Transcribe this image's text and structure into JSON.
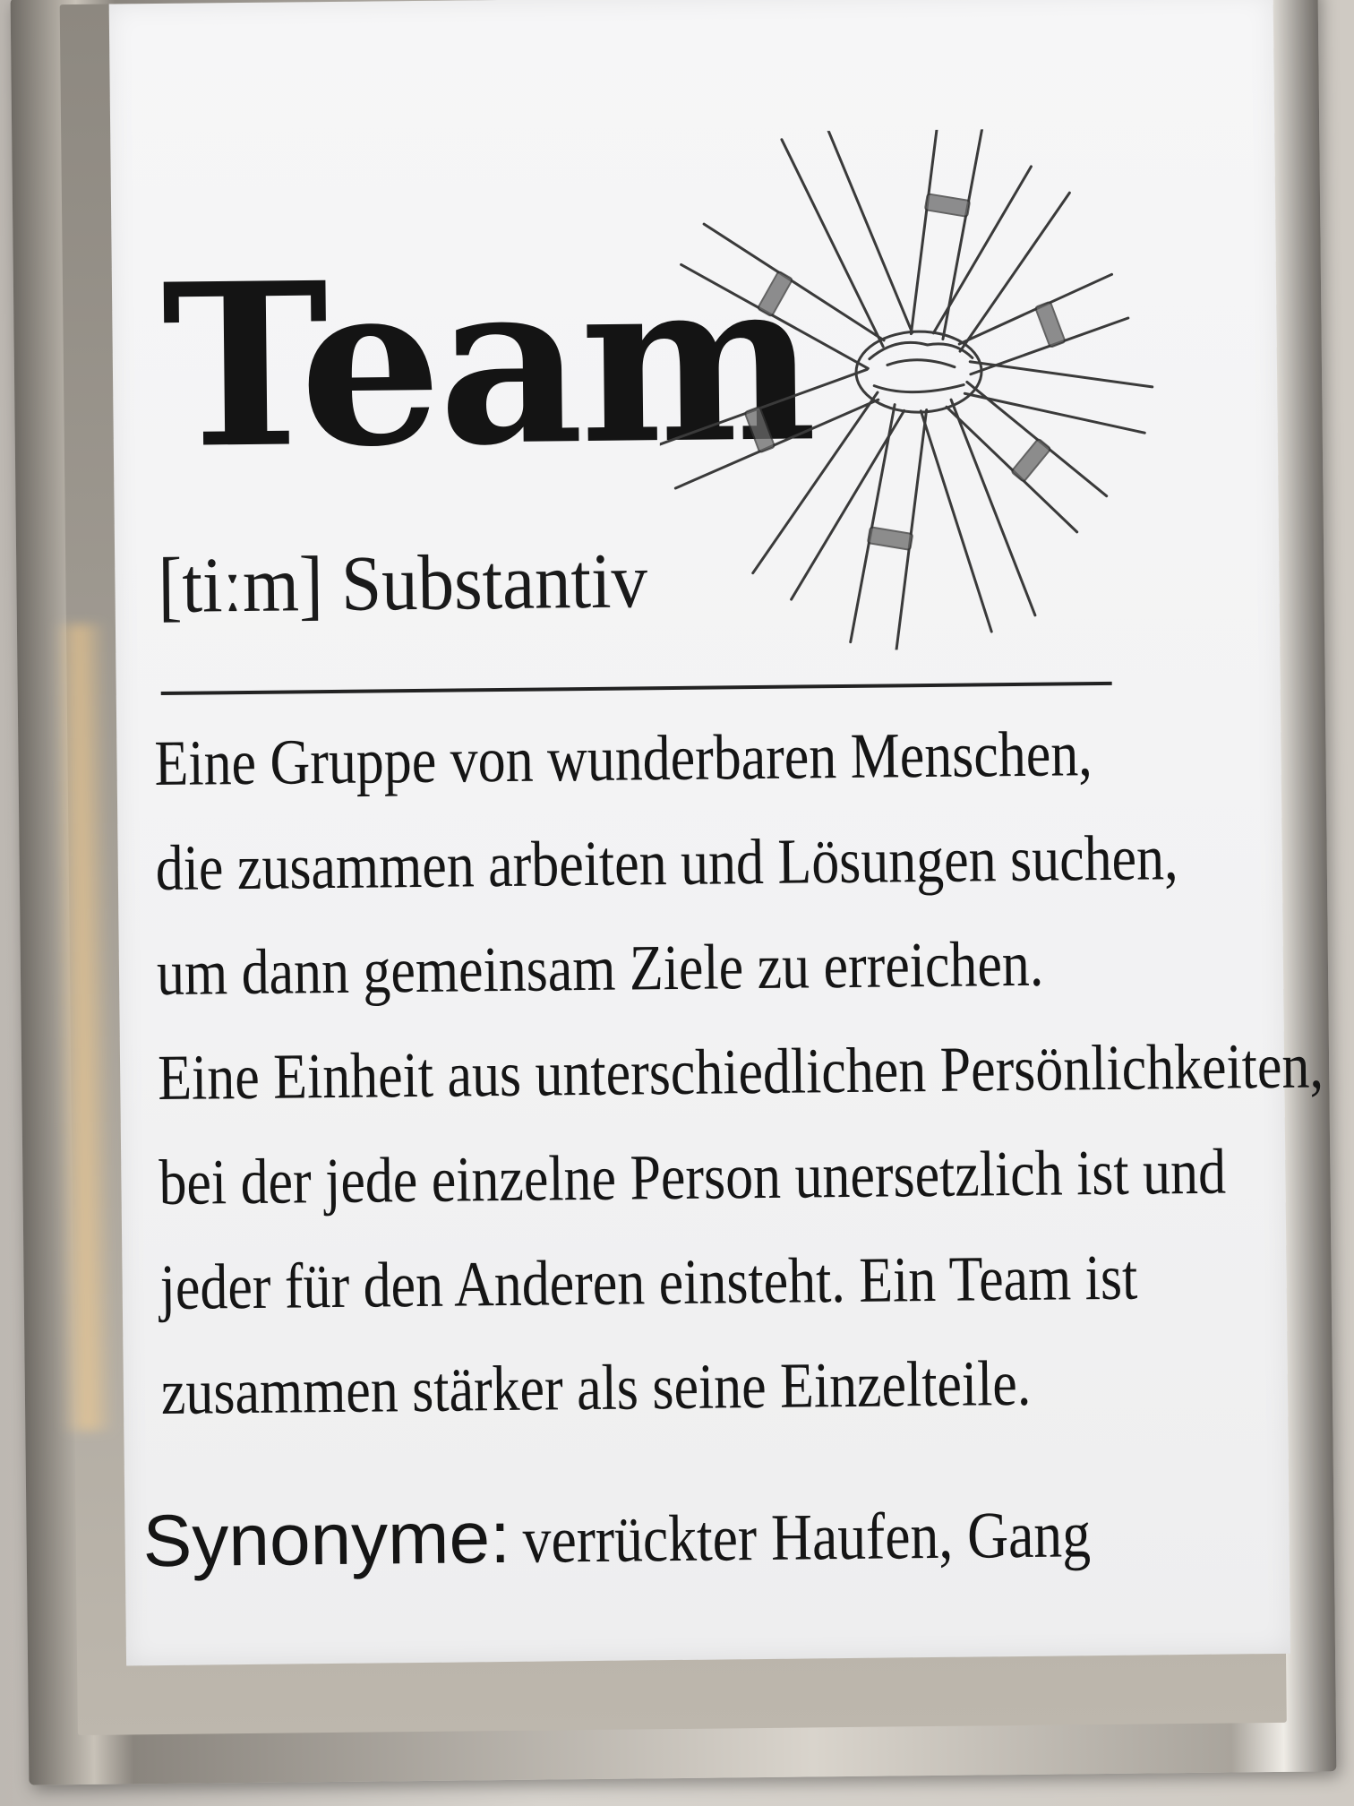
{
  "poster": {
    "title": "Team",
    "phonetic": "[tiːm] Substantiv",
    "definition_lines": [
      "Eine Gruppe von wunderbaren Menschen,",
      "die zusammen arbeiten und Lösungen suchen,",
      "um dann gemeinsam Ziele zu erreichen.",
      "Eine Einheit aus unterschiedlichen Persönlichkeiten,",
      "bei der jede einzelne Person unersetzlich ist und",
      "jeder für den Anderen einsteht. Ein Team ist",
      "zusammen stärker als seine Einzelteile."
    ],
    "synonyms_label": "Synonyme:",
    "synonyms_value": "verrückter Haufen, Gang"
  },
  "illustration": {
    "icon": "stacked-hands-icon",
    "ink_color": "#3a3a3a"
  },
  "colors": {
    "paper": "#f4f4f5",
    "text": "#151515",
    "frame": "#bdb7ad"
  }
}
